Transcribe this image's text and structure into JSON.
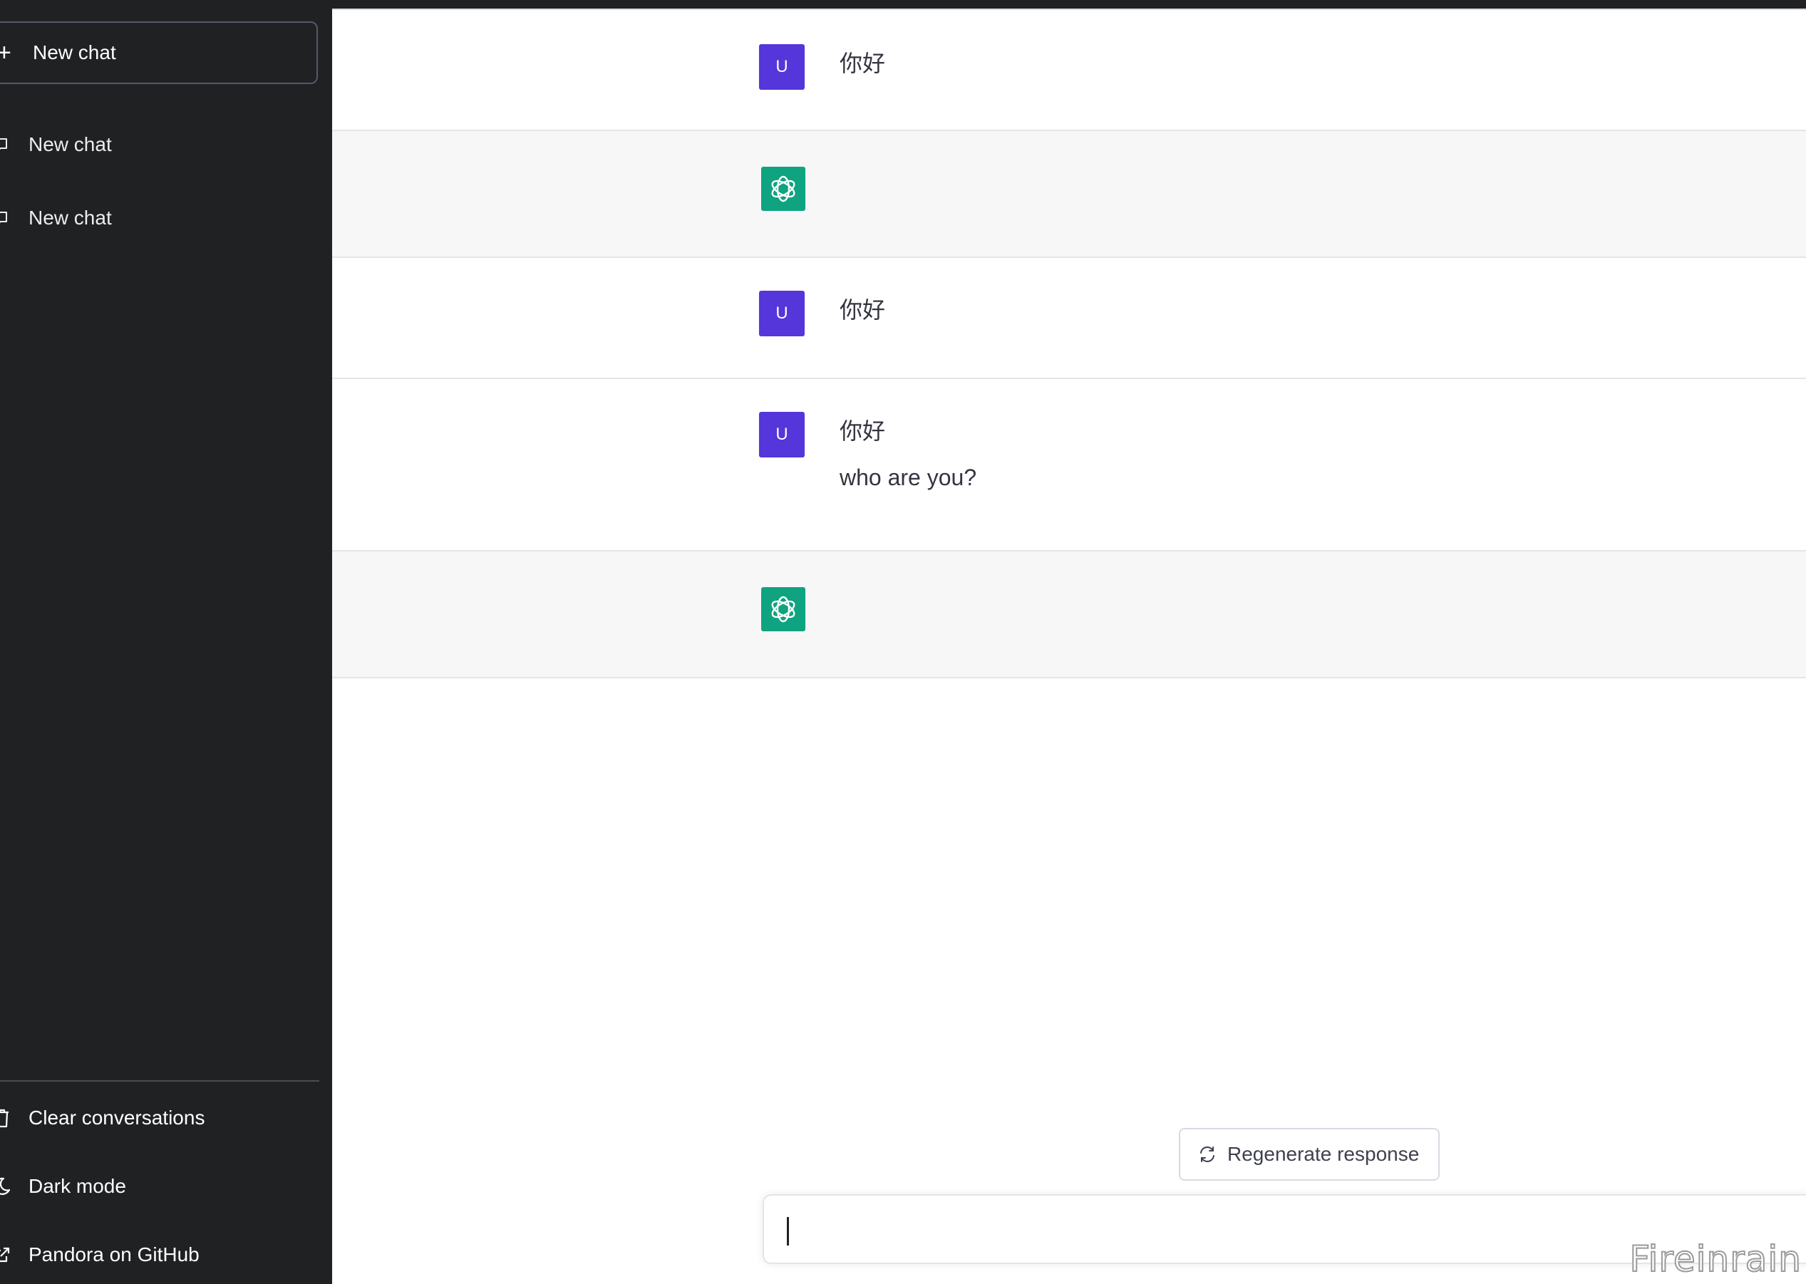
{
  "sidebar": {
    "new_chat_label": "New chat",
    "conversations": [
      {
        "label": "New chat"
      },
      {
        "label": "New chat"
      }
    ],
    "bottom": {
      "clear_label": "Clear conversations",
      "dark_mode_label": "Dark mode",
      "github_label": "Pandora on GitHub"
    }
  },
  "messages": [
    {
      "role": "user",
      "avatar": "U",
      "lines": [
        "你好"
      ]
    },
    {
      "role": "assistant",
      "lines": []
    },
    {
      "role": "user",
      "avatar": "U",
      "lines": [
        "你好"
      ]
    },
    {
      "role": "user",
      "avatar": "U",
      "lines": [
        "你好",
        "who are you?"
      ]
    },
    {
      "role": "assistant",
      "lines": []
    }
  ],
  "composer": {
    "regenerate_label": "Regenerate response",
    "input_value": "",
    "input_placeholder": ""
  },
  "watermark": "Fireinrain",
  "colors": {
    "sidebar_bg": "#202123",
    "user_avatar": "#5436da",
    "assistant_avatar": "#10a37f",
    "assistant_row_bg": "#f7f7f8"
  },
  "icons": {
    "new_chat": "plus-icon",
    "conversation": "chat-bubble-icon",
    "clear": "trash-icon",
    "dark_mode": "moon-icon",
    "github": "external-link-icon",
    "regenerate": "refresh-icon",
    "assistant": "openai-logo-icon"
  }
}
